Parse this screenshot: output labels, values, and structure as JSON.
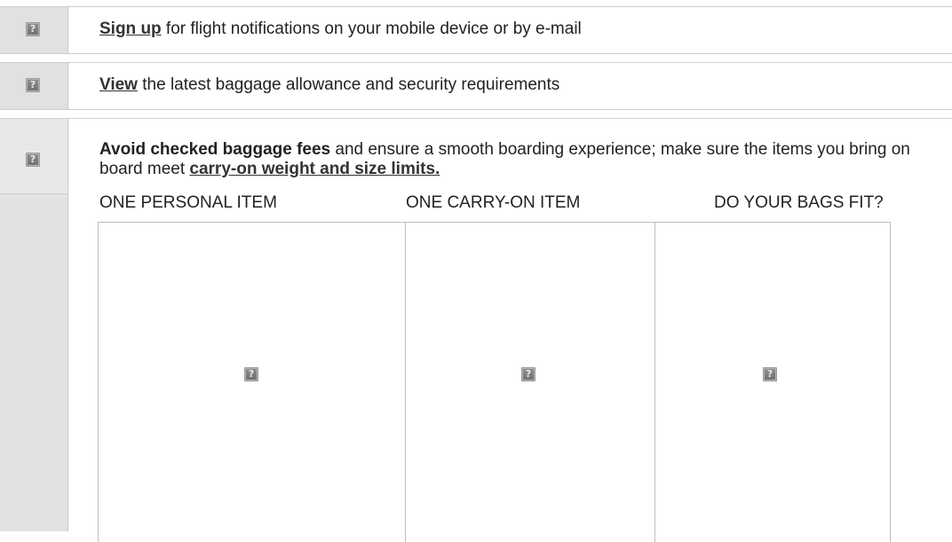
{
  "rows": [
    {
      "link": "Sign up",
      "text": " for flight notifications on your mobile device or by e-mail"
    },
    {
      "link": "View",
      "text": " the latest baggage allowance and security requirements"
    }
  ],
  "baggage": {
    "bold_lead": "Avoid checked baggage fees",
    "text_mid": " and ensure a smooth boarding experience; make sure the items you bring on board meet ",
    "link": "carry-on weight and size limits.",
    "columns": [
      {
        "title": "ONE PERSONAL ITEM"
      },
      {
        "title": "ONE CARRY-ON ITEM"
      },
      {
        "title": "DO YOUR BAGS FIT?"
      }
    ]
  },
  "broken_image_glyph": "?",
  "icons": {
    "gutter": "broken-image-icon",
    "panel": "broken-image-icon"
  },
  "colors": {
    "gutter": "#e1e1e1",
    "border": "#cfcfcf",
    "text": "#222222"
  }
}
